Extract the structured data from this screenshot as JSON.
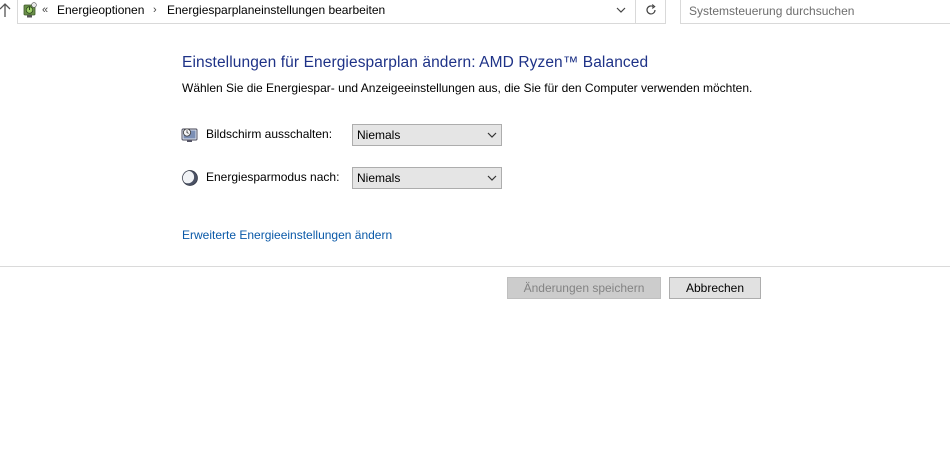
{
  "address_bar": {
    "overflow_chevron": "«",
    "breadcrumbs": [
      {
        "label": "Energieoptionen"
      },
      {
        "label": "Energiesparplaneinstellungen bearbeiten"
      }
    ],
    "separator": "›"
  },
  "search": {
    "placeholder": "Systemsteuerung durchsuchen"
  },
  "page": {
    "title": "Einstellungen für Energiesparplan ändern: AMD Ryzen™ Balanced",
    "subtitle": "Wählen Sie die Energiespar- und Anzeigeeinstellungen aus, die Sie für den Computer verwenden möchten."
  },
  "settings": [
    {
      "label": "Bildschirm ausschalten:",
      "value": "Niemals",
      "icon": "monitor-clock-icon"
    },
    {
      "label": "Energiesparmodus nach:",
      "value": "Niemals",
      "icon": "moon-icon"
    }
  ],
  "advanced_link": "Erweiterte Energieeinstellungen ändern",
  "buttons": {
    "save": "Änderungen speichern",
    "cancel": "Abbrechen"
  },
  "colors": {
    "title": "#1e3287",
    "link": "#0a59a8"
  }
}
